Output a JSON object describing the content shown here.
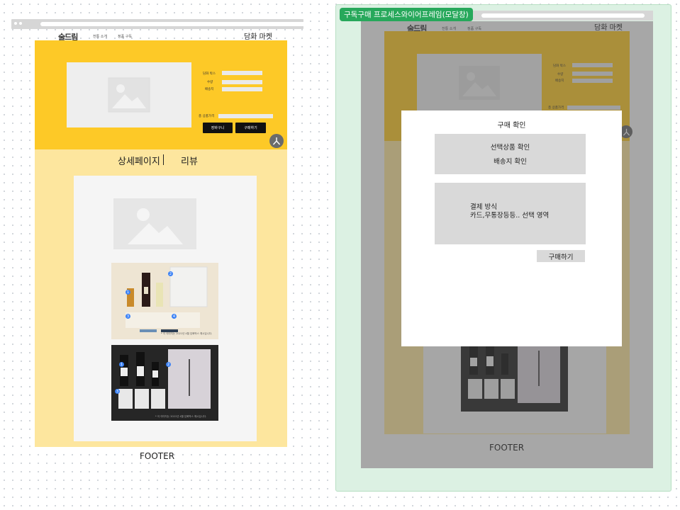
{
  "left_frame": {
    "logo": "술드림",
    "nav": [
      "전통 소개",
      "정품 구독"
    ],
    "market_title": "담화 마켓",
    "form": {
      "labels": [
        "담화 박스",
        "수량",
        "배송지"
      ],
      "total_label": "총 상품가격"
    },
    "buttons": {
      "cart": "장바구니",
      "buy": "구매하기"
    },
    "tabs": {
      "detail": "상세페이지",
      "review": "리뷰"
    },
    "footer": "FOOTER",
    "photo_caption": "* 이 이미지는 2021년 4월 담화박스 예시입니다.",
    "numbers": [
      "1",
      "2",
      "3",
      "4"
    ]
  },
  "right_frame": {
    "label": "구독구매 프로세스와이어프레임(모달창)",
    "logo": "술드림",
    "nav": [
      "전통 소개",
      "정품 구독"
    ],
    "market_title": "담화 마켓",
    "form": {
      "labels": [
        "담화 박스",
        "수량",
        "배송지"
      ],
      "total_label": "총 상품가격"
    },
    "footer": "FOOTER",
    "modal": {
      "title": "구매 확인",
      "line1": "선택상품 확인",
      "line2": "배송지 확인",
      "payment_title": "결제 방식",
      "payment_desc": "카드,무통장등등.. 선택 영역",
      "button": "구매하기"
    }
  },
  "colors": {
    "hero_yellow": "#fdc927",
    "detail_yellow": "#fde69e",
    "frame_green": "#27a85b",
    "panel_green": "#dcf1e3",
    "placeholder_gray": "#eeeeee",
    "modal_box_gray": "#d9d9d9",
    "badge_blue": "#3b82f6"
  },
  "icons": [
    "image-placeholder-icon",
    "person-icon",
    "number-badge"
  ]
}
